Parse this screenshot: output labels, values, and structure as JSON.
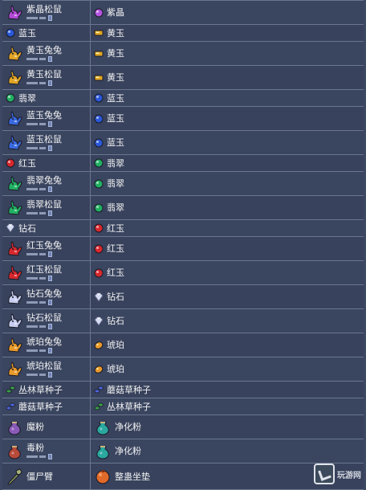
{
  "rows": [
    {
      "left": {
        "name": "紫晶松鼠",
        "icon": "squirrel-amethyst-icon",
        "color": "#b24ad6",
        "kind": "critter"
      },
      "right": {
        "name": "紫晶",
        "icon": "amethyst-gem-icon",
        "color": "#b455e0",
        "kind": "gem"
      }
    },
    {
      "left": {
        "name": "蓝玉",
        "icon": "sapphire-gem-icon",
        "color": "#2a58d8",
        "kind": "gem"
      },
      "right": {
        "name": "黄玉",
        "icon": "topaz-gem-icon",
        "color": "#e0a526",
        "kind": "bar"
      }
    },
    {
      "left": {
        "name": "黄玉兔兔",
        "icon": "bunny-topaz-icon",
        "color": "#e0a526",
        "kind": "critter"
      },
      "right": {
        "name": "黄玉",
        "icon": "topaz-gem-icon",
        "color": "#e0a526",
        "kind": "bar"
      }
    },
    {
      "left": {
        "name": "黄玉松鼠",
        "icon": "squirrel-topaz-icon",
        "color": "#e0a526",
        "kind": "critter"
      },
      "right": {
        "name": "黄玉",
        "icon": "topaz-gem-icon",
        "color": "#e0a526",
        "kind": "bar"
      }
    },
    {
      "left": {
        "name": "翡翠",
        "icon": "emerald-gem-icon",
        "color": "#22b062",
        "kind": "gem"
      },
      "right": {
        "name": "蓝玉",
        "icon": "sapphire-gem-icon",
        "color": "#2a58d8",
        "kind": "gem"
      }
    },
    {
      "left": {
        "name": "蓝玉兔兔",
        "icon": "bunny-sapphire-icon",
        "color": "#3a6ae0",
        "kind": "critter"
      },
      "right": {
        "name": "蓝玉",
        "icon": "sapphire-gem-icon",
        "color": "#2a58d8",
        "kind": "gem"
      }
    },
    {
      "left": {
        "name": "蓝玉松鼠",
        "icon": "squirrel-sapphire-icon",
        "color": "#3a6ae0",
        "kind": "critter"
      },
      "right": {
        "name": "蓝玉",
        "icon": "sapphire-gem-icon",
        "color": "#2a58d8",
        "kind": "gem"
      }
    },
    {
      "left": {
        "name": "红玉",
        "icon": "ruby-gem-icon",
        "color": "#d8282e",
        "kind": "gem"
      },
      "right": {
        "name": "翡翠",
        "icon": "emerald-gem-icon",
        "color": "#22b062",
        "kind": "gem"
      }
    },
    {
      "left": {
        "name": "翡翠兔兔",
        "icon": "bunny-emerald-icon",
        "color": "#22b062",
        "kind": "critter"
      },
      "right": {
        "name": "翡翠",
        "icon": "emerald-gem-icon",
        "color": "#22b062",
        "kind": "gem"
      }
    },
    {
      "left": {
        "name": "翡翠松鼠",
        "icon": "squirrel-emerald-icon",
        "color": "#22b062",
        "kind": "critter"
      },
      "right": {
        "name": "翡翠",
        "icon": "emerald-gem-icon",
        "color": "#22b062",
        "kind": "gem"
      }
    },
    {
      "left": {
        "name": "钻石",
        "icon": "diamond-gem-icon",
        "color": "#d6dcf2",
        "kind": "diamond"
      },
      "right": {
        "name": "红玉",
        "icon": "ruby-gem-icon",
        "color": "#d8282e",
        "kind": "gem"
      }
    },
    {
      "left": {
        "name": "红玉兔兔",
        "icon": "bunny-ruby-icon",
        "color": "#d8282e",
        "kind": "critter"
      },
      "right": {
        "name": "红玉",
        "icon": "ruby-gem-icon",
        "color": "#d8282e",
        "kind": "gem"
      }
    },
    {
      "left": {
        "name": "红玉松鼠",
        "icon": "squirrel-ruby-icon",
        "color": "#d8282e",
        "kind": "critter"
      },
      "right": {
        "name": "红玉",
        "icon": "ruby-gem-icon",
        "color": "#d8282e",
        "kind": "gem"
      }
    },
    {
      "left": {
        "name": "钻石兔兔",
        "icon": "bunny-diamond-icon",
        "color": "#c8cef0",
        "kind": "critter"
      },
      "right": {
        "name": "钻石",
        "icon": "diamond-gem-icon",
        "color": "#d6dcf2",
        "kind": "diamond"
      }
    },
    {
      "left": {
        "name": "钻石松鼠",
        "icon": "squirrel-diamond-icon",
        "color": "#c8cef0",
        "kind": "critter"
      },
      "right": {
        "name": "钻石",
        "icon": "diamond-gem-icon",
        "color": "#d6dcf2",
        "kind": "diamond"
      }
    },
    {
      "left": {
        "name": "琥珀兔兔",
        "icon": "bunny-amber-icon",
        "color": "#e89a2a",
        "kind": "critter"
      },
      "right": {
        "name": "琥珀",
        "icon": "amber-gem-icon",
        "color": "#e89a2a",
        "kind": "amber"
      }
    },
    {
      "left": {
        "name": "琥珀松鼠",
        "icon": "squirrel-amber-icon",
        "color": "#e89a2a",
        "kind": "critter"
      },
      "right": {
        "name": "琥珀",
        "icon": "amber-gem-icon",
        "color": "#e89a2a",
        "kind": "amber"
      }
    },
    {
      "left": {
        "name": "丛林草种子",
        "icon": "jungle-grass-seeds-icon",
        "color": "#3aa04a",
        "kind": "seeds"
      },
      "right": {
        "name": "蘑菇草种子",
        "icon": "mushroom-grass-seeds-icon",
        "color": "#4a64d8",
        "kind": "seeds"
      }
    },
    {
      "left": {
        "name": "蘑菇草种子",
        "icon": "mushroom-grass-seeds-icon",
        "color": "#4a64d8",
        "kind": "seeds"
      },
      "right": {
        "name": "丛林草种子",
        "icon": "jungle-grass-seeds-icon",
        "color": "#3aa04a",
        "kind": "seeds"
      }
    },
    {
      "left": {
        "name": "魔粉",
        "icon": "vile-powder-icon",
        "color": "#8a5ab8",
        "kind": "pouch"
      },
      "right": {
        "name": "净化粉",
        "icon": "purification-powder-icon",
        "color": "#2aa8a0",
        "kind": "pouch"
      }
    },
    {
      "left": {
        "name": "毒粉",
        "icon": "vicious-powder-icon",
        "color": "#b84a3a",
        "kind": "pouch",
        "sub": true
      },
      "right": {
        "name": "净化粉",
        "icon": "purification-powder-icon",
        "color": "#2aa8a0",
        "kind": "pouch"
      }
    },
    {
      "left": {
        "name": "僵尸臂",
        "icon": "zombie-arm-icon",
        "color": "#8a9a5a",
        "kind": "arm"
      },
      "right": {
        "name": "整蛊坐垫",
        "icon": "whoopie-cushion-icon",
        "color": "#e06a2a",
        "kind": "cushion"
      }
    }
  ],
  "watermark": {
    "text": "玩游网",
    "icon": "site-logo-icon"
  }
}
